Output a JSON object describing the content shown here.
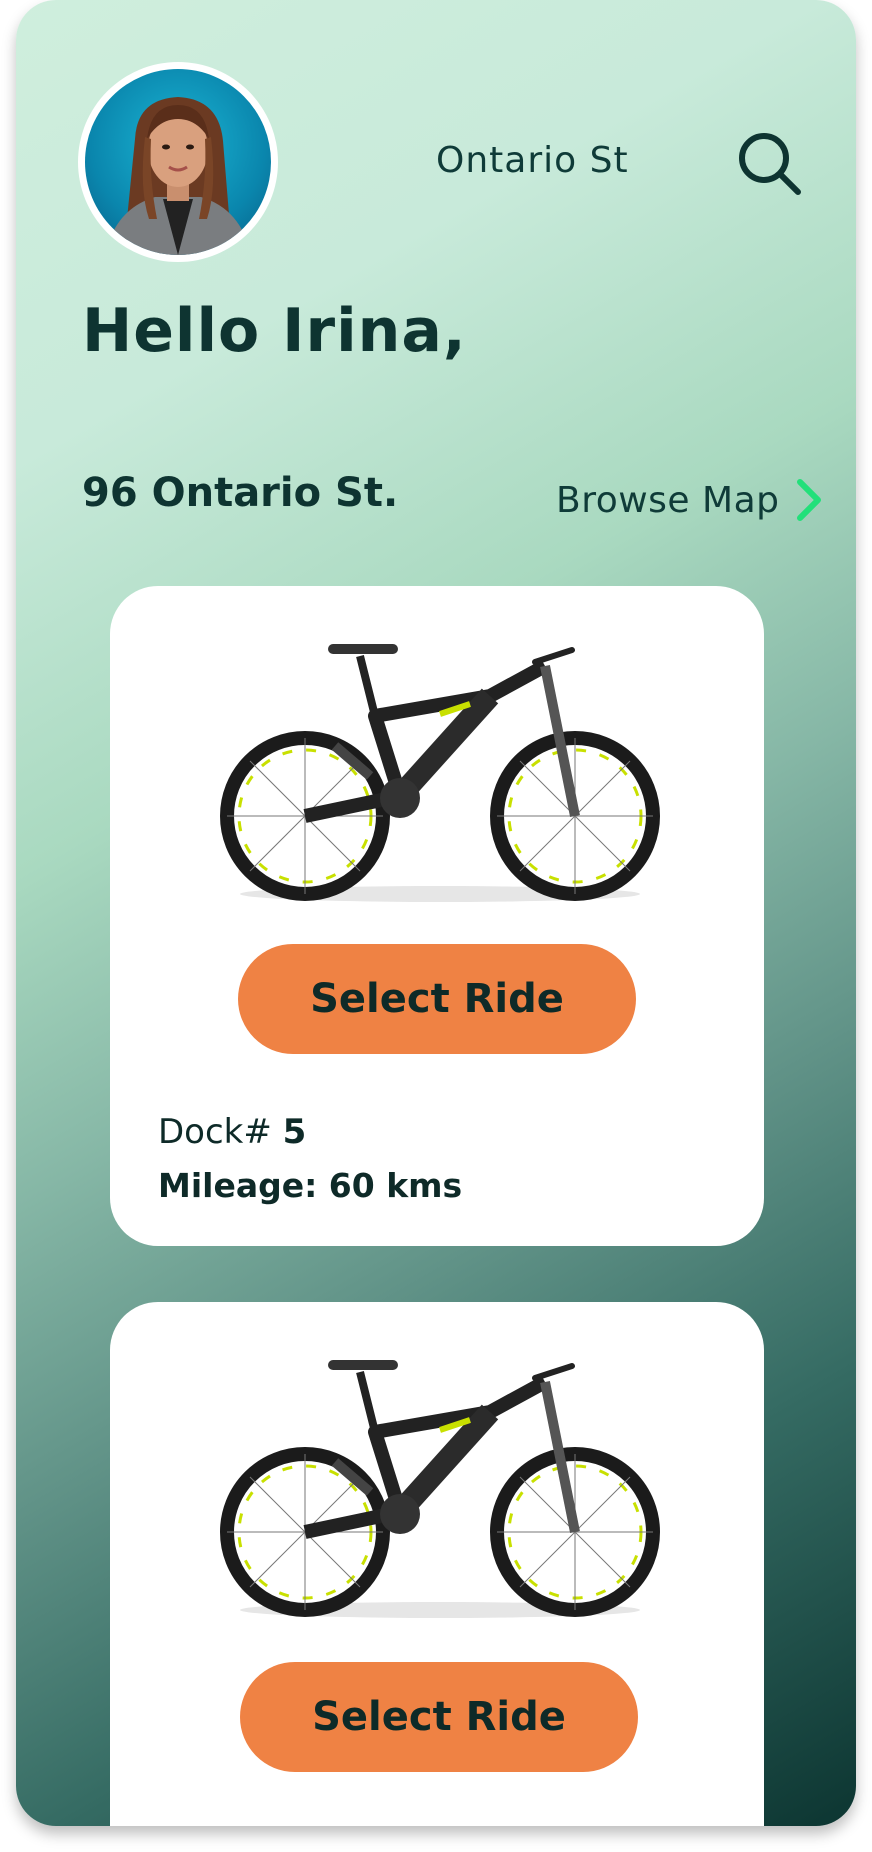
{
  "header": {
    "location_label": "Ontario St",
    "greeting": "Hello Irina,",
    "avatar_icon": "user-avatar",
    "search_icon": "search-icon"
  },
  "address_bar": {
    "address": "96 Ontario St.",
    "browse_label": "Browse Map",
    "browse_icon": "chevron-right-icon",
    "accent_color": "#22e07a"
  },
  "rides": [
    {
      "button_label": "Select Ride",
      "dock_prefix": "Dock# ",
      "dock_number": "5",
      "mileage": "Mileage: 60 kms"
    },
    {
      "button_label": "Select Ride"
    }
  ],
  "colors": {
    "button": "#ef8244",
    "text_dark": "#0e3431",
    "bike_accent": "#c8e000"
  }
}
